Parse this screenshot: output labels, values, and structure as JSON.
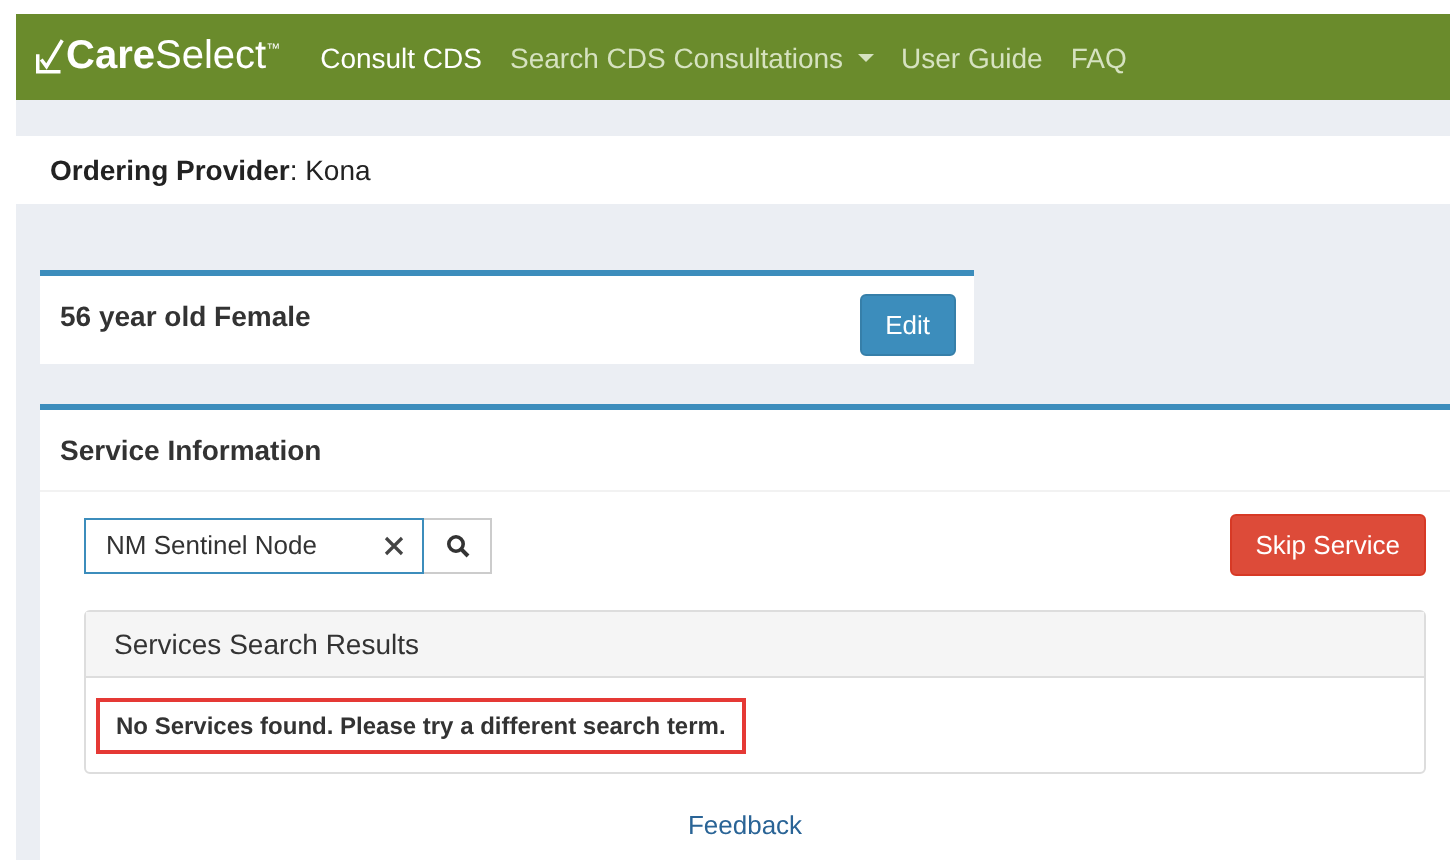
{
  "navbar": {
    "logo": "**Care**Select$^{™}$",
    "items": [
      {
        "label": "Consult CDS",
        "selected": true,
        "kind": "link"
      },
      {
        "label": "Search CDS Consultations",
        "selected": false,
        "kind": "dropdown"
      },
      {
        "label": "User Guide",
        "selected": false,
        "kind": "link"
      },
      {
        "label": "FAQ",
        "selected": false,
        "kind": "link"
      }
    ]
  },
  "provider": "**Ordering Provider**: Kona",
  "patient": {
    "summary": "56 year old Female",
    "edit_button": "Edit"
  },
  "service": {
    "title": "Service Information",
    "search": {
      "value": "NM Sentinel Node"
    },
    "skip_button": "Skip Service",
    "results": {
      "title": "Services Search Results",
      "message": "No Services found. Please try a different search term.",
      "highlighted": true
    }
  },
  "footer_link": "Feedback"
}
